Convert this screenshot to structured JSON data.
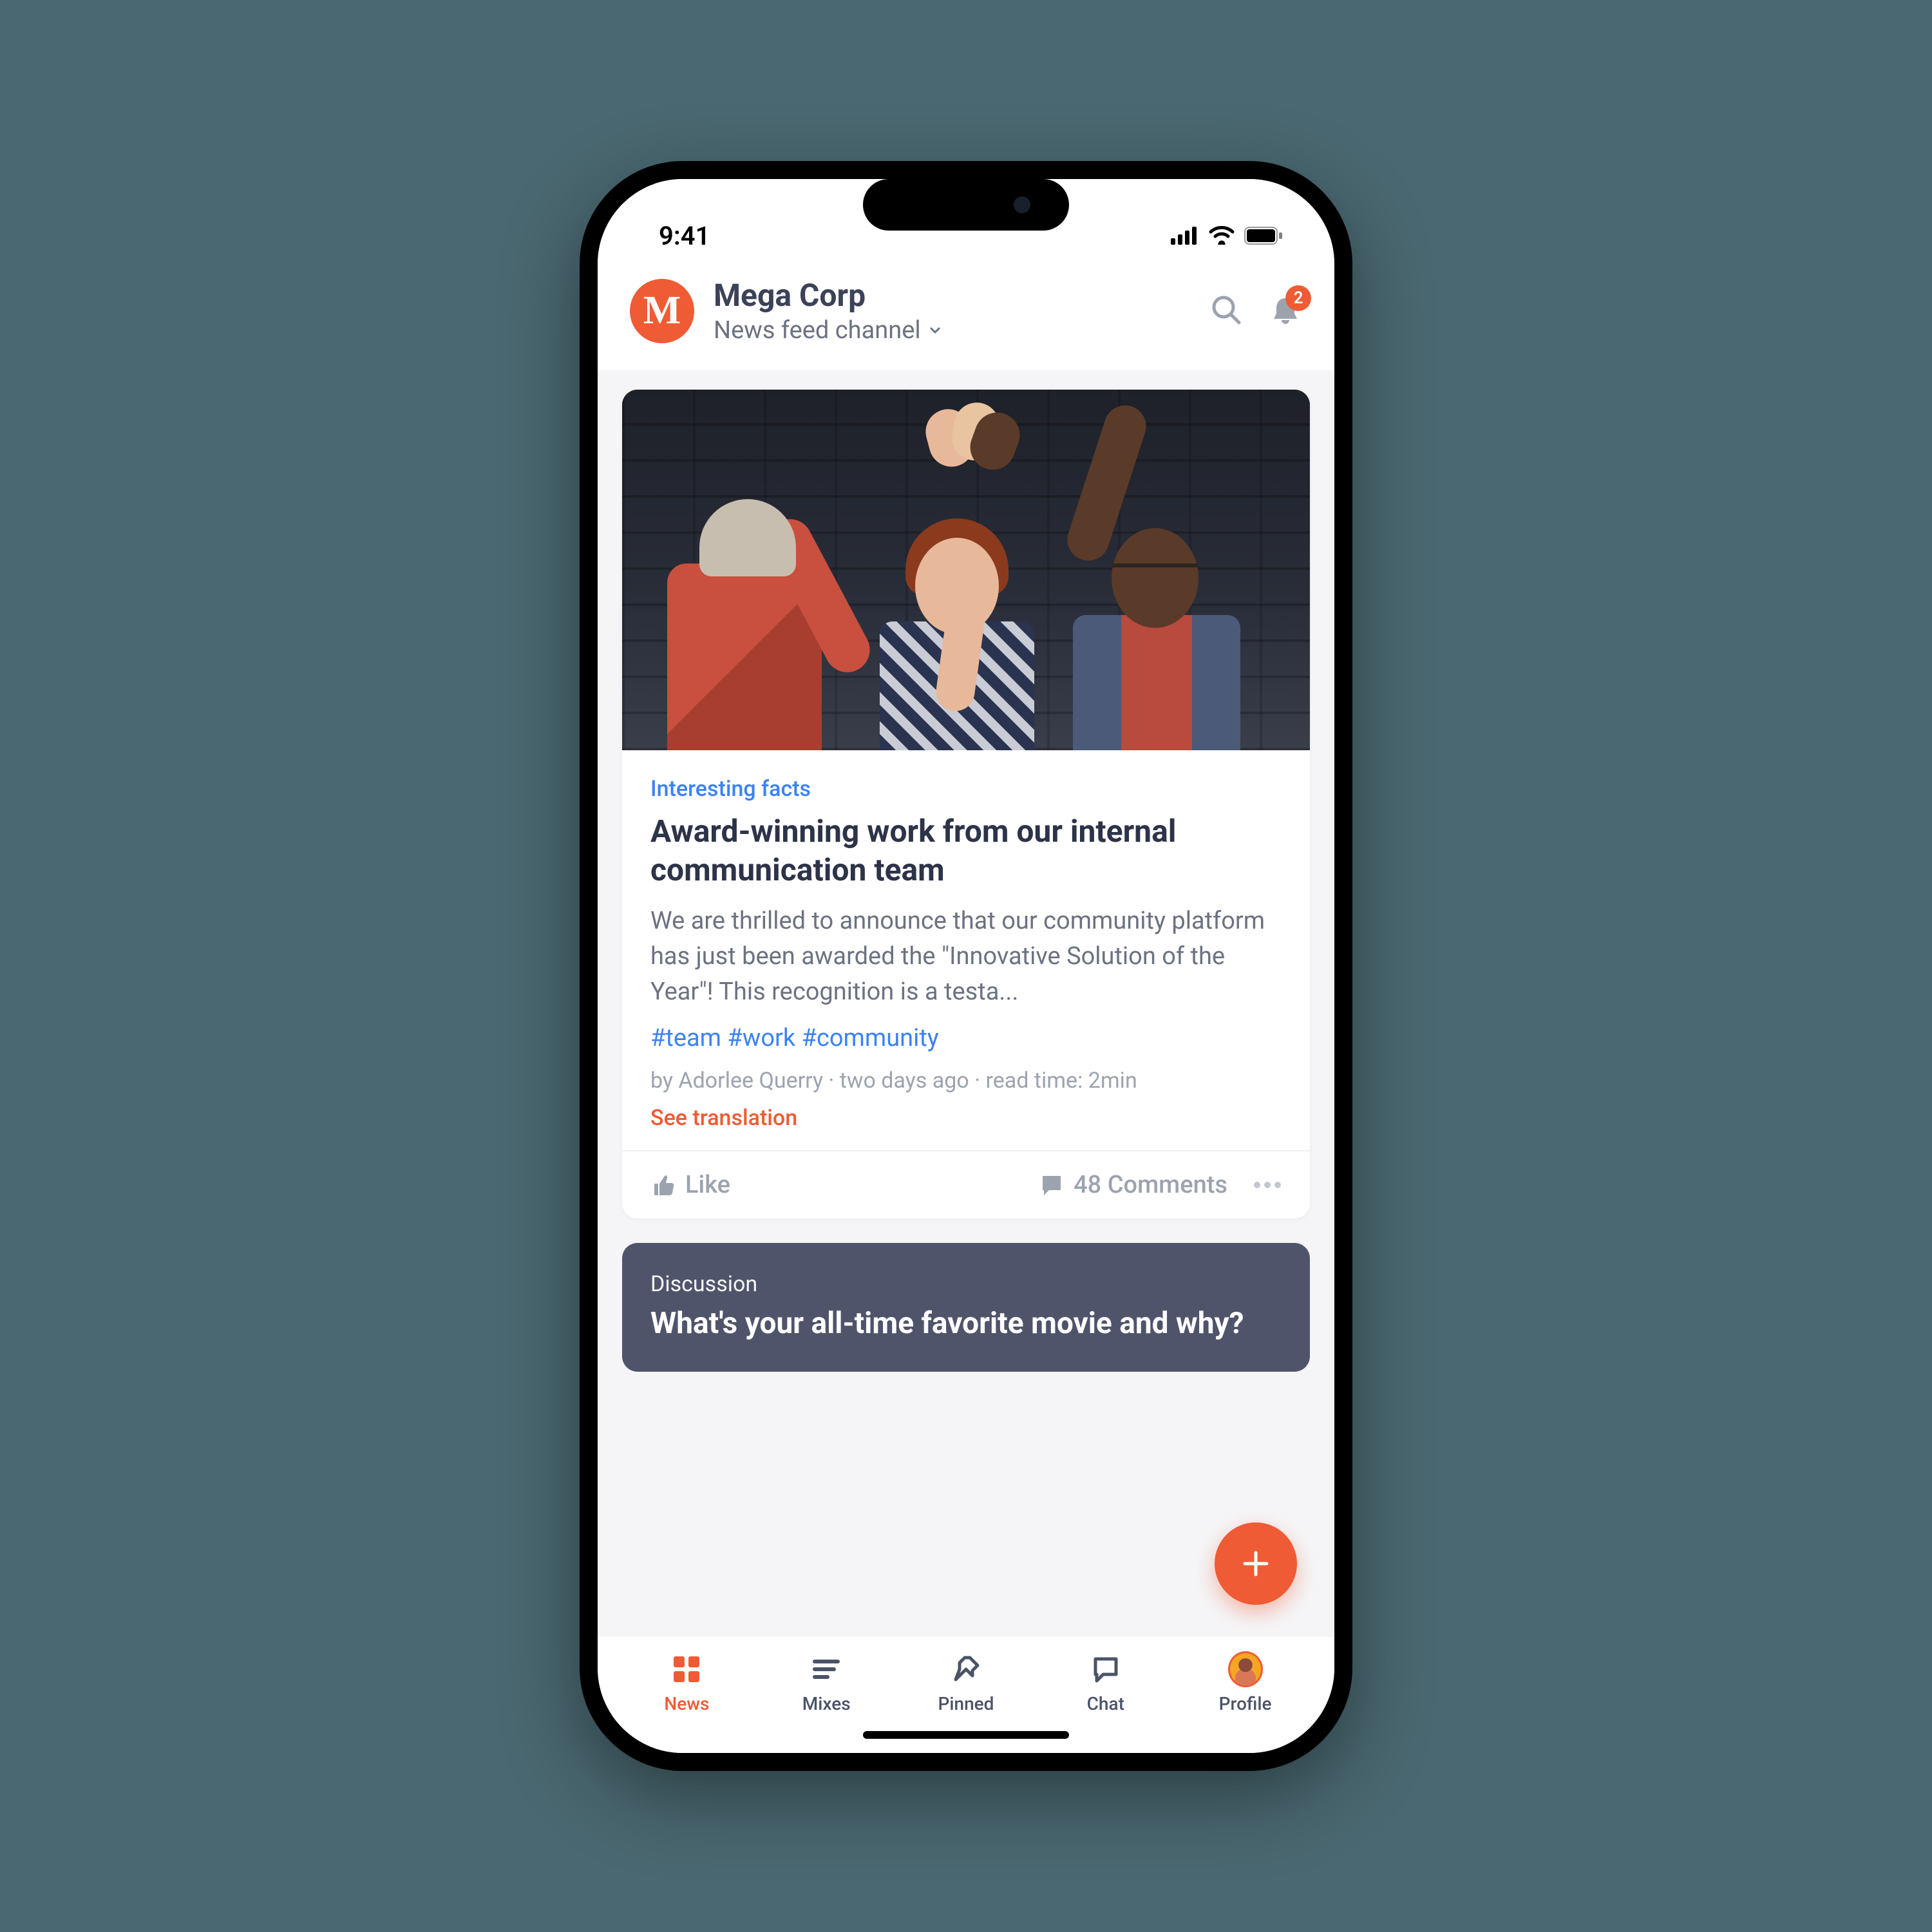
{
  "status": {
    "time": "9:41"
  },
  "header": {
    "logo_letter": "M",
    "title": "Mega Corp",
    "subtitle": "News feed channel",
    "notification_count": "2"
  },
  "post": {
    "category": "Interesting facts",
    "title": "Award-winning work from our internal communication team",
    "excerpt": "We are thrilled to announce that our community platform has just been awarded the \"Innovative Solution of the Year\"! This recognition is a testa...",
    "hashtags": "#team #work #community",
    "meta": "by Adorlee Querry · two days ago · read time: 2min",
    "translation": "See translation",
    "like_label": "Like",
    "comments_label": "48 Comments"
  },
  "discussion": {
    "label": "Discussion",
    "title": "What's your all-time favorite movie and why?"
  },
  "nav": {
    "news": "News",
    "mixes": "Mixes",
    "pinned": "Pinned",
    "chat": "Chat",
    "profile": "Profile"
  }
}
